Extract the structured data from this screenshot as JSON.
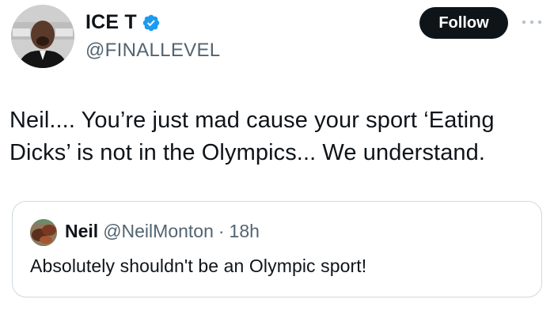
{
  "author": {
    "display_name": "ICE T",
    "handle": "@FINALLEVEL",
    "verified": true,
    "avatar_icon": "profile-photo"
  },
  "actions": {
    "follow_label": "Follow",
    "more_icon": "more-horizontal-icon"
  },
  "tweet": {
    "text": "Neil.... You’re just mad cause your sport ‘Eating Dicks’ is not in the Olympics... We understand."
  },
  "quote": {
    "display_name": "Neil",
    "handle": "@NeilMonton",
    "separator": "·",
    "time": "18h",
    "text": "Absolutely shouldn't be an Olympic sport!"
  },
  "colors": {
    "verified_blue": "#1d9bf0",
    "text_primary": "#0f1419",
    "text_secondary": "#536471",
    "border": "#cfd9de",
    "button_bg": "#0f1419"
  }
}
